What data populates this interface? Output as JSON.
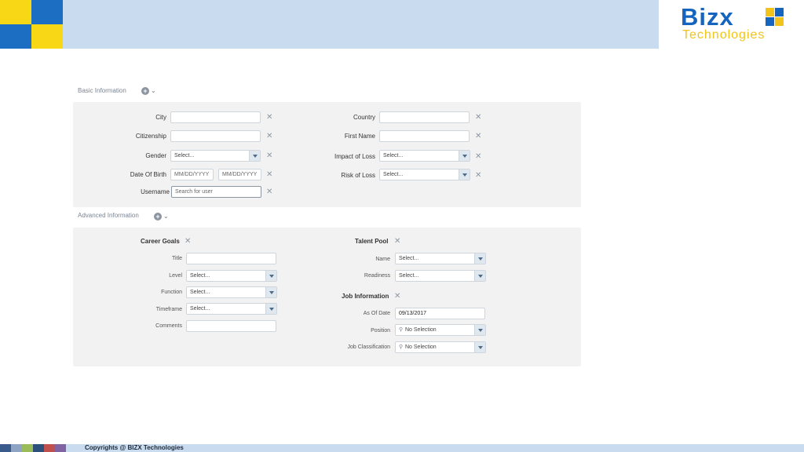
{
  "brand": {
    "name": "Bizx",
    "subtitle": "Technologies",
    "colors": {
      "blue": "#1565c0",
      "yellow": "#f2c31b",
      "band": "#c9dbef"
    }
  },
  "basic_section": {
    "title": "Basic Information",
    "left": [
      {
        "label": "City",
        "kind": "text",
        "value": ""
      },
      {
        "label": "Citizenship",
        "kind": "text",
        "value": ""
      },
      {
        "label": "Gender",
        "kind": "select",
        "value": "Select..."
      },
      {
        "label": "Date Of Birth",
        "kind": "daterange",
        "from": "MM/DD/YYYY",
        "to": "MM/DD/YYYY"
      },
      {
        "label": "Username",
        "kind": "search",
        "placeholder": "Search for user"
      }
    ],
    "right": [
      {
        "label": "Country",
        "kind": "text",
        "value": ""
      },
      {
        "label": "First Name",
        "kind": "text",
        "value": ""
      },
      {
        "label": "Impact of Loss",
        "kind": "select",
        "value": "Select..."
      },
      {
        "label": "Risk of Loss",
        "kind": "select",
        "value": "Select..."
      }
    ]
  },
  "advanced_section": {
    "title": "Advanced Information",
    "career_goals": {
      "title": "Career Goals",
      "fields": [
        {
          "label": "Title",
          "kind": "text",
          "value": ""
        },
        {
          "label": "Level",
          "kind": "select",
          "value": "Select..."
        },
        {
          "label": "Function",
          "kind": "select",
          "value": "Select..."
        },
        {
          "label": "Timeframe",
          "kind": "select",
          "value": "Select..."
        },
        {
          "label": "Comments",
          "kind": "text",
          "value": ""
        }
      ]
    },
    "talent_pool": {
      "title": "Talent Pool",
      "fields": [
        {
          "label": "Name",
          "kind": "select",
          "value": "Select..."
        },
        {
          "label": "Readiness",
          "kind": "select",
          "value": "Select..."
        }
      ]
    },
    "job_information": {
      "title": "Job Information",
      "fields": [
        {
          "label": "As Of Date",
          "kind": "text",
          "value": "09/13/2017"
        },
        {
          "label": "Position",
          "kind": "searchselect",
          "value": "No Selection"
        },
        {
          "label": "Job Classification",
          "kind": "searchselect",
          "value": "No Selection"
        }
      ]
    }
  },
  "icons": {
    "add": "plus-circle-icon",
    "expand": "chevron-down-icon",
    "remove": "close-icon",
    "dropdown": "triangle-down-icon",
    "search": "magnifier-icon"
  },
  "footer": {
    "text": "Copyrights @ BIZX Technologies"
  }
}
